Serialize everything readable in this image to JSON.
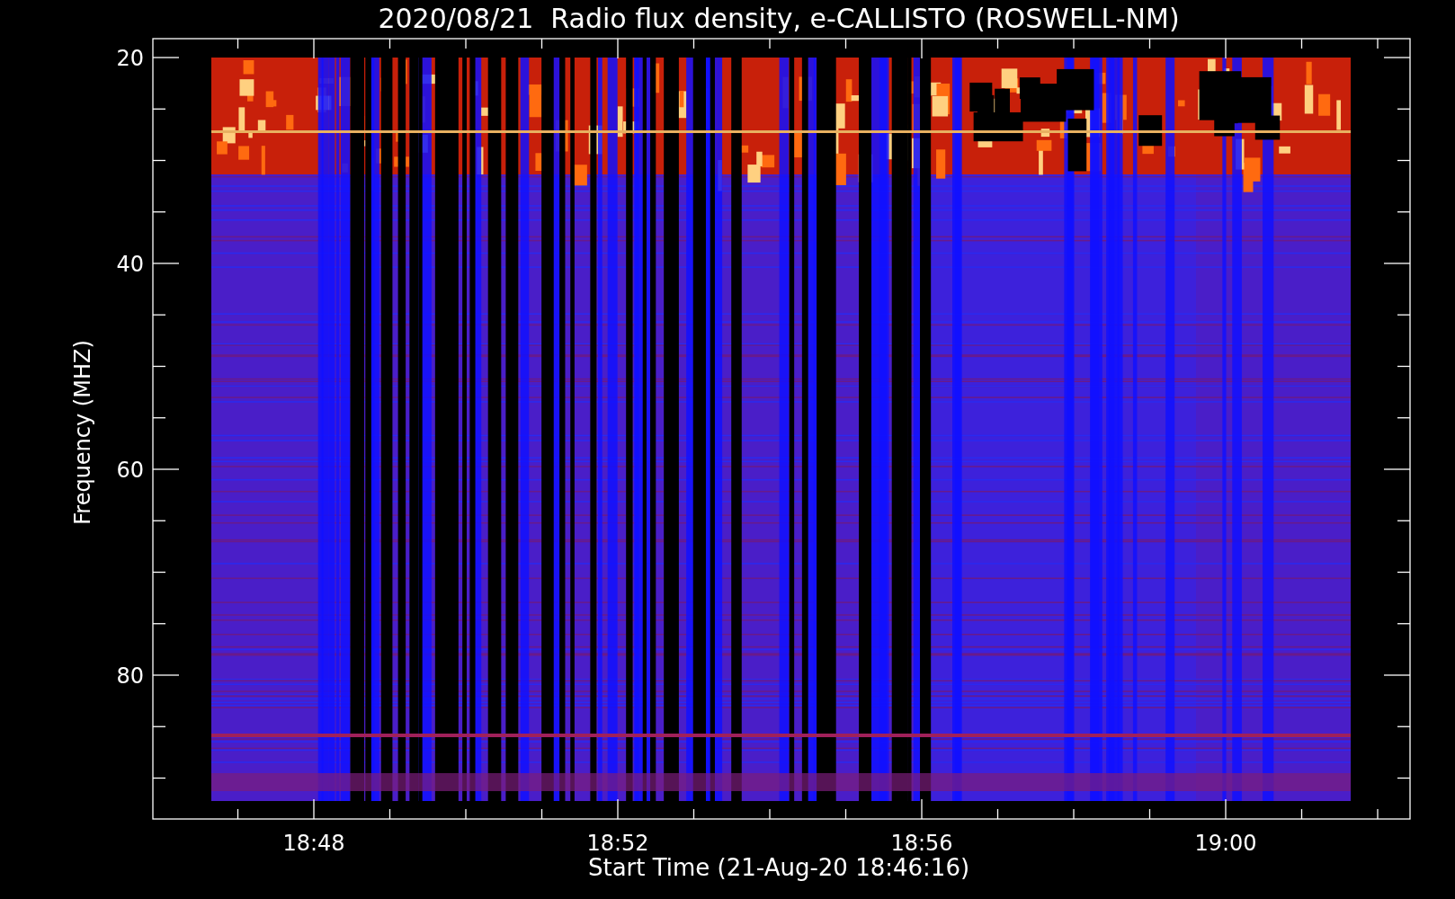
{
  "title": "2020/08/21  Radio flux density, e-CALLISTO (ROSWELL-NM)",
  "y_axis": {
    "label": "Frequency (MHZ)",
    "ticks": [
      "20",
      "40",
      "60",
      "80"
    ]
  },
  "x_axis": {
    "label": "Start Time (21-Aug-20 18:46:16)",
    "ticks": [
      "18:48",
      "18:52",
      "18:56",
      "19:00"
    ]
  }
}
